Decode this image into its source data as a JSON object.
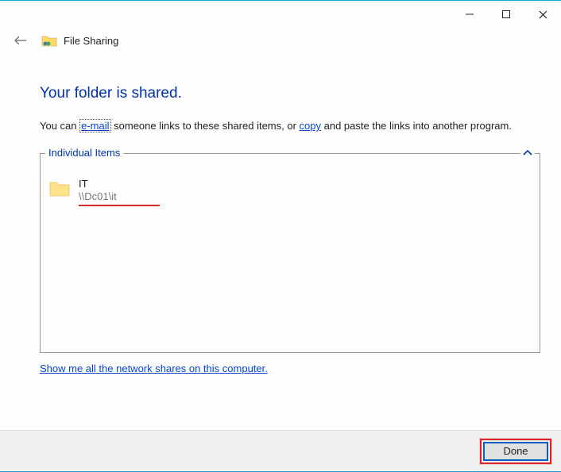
{
  "window": {
    "title": "File Sharing"
  },
  "heading": "Your folder is shared.",
  "paragraph": {
    "prefix": "You can ",
    "link1": "e-mail",
    "mid": " someone links to these shared items, or ",
    "link2": "copy",
    "suffix": " and paste the links into another program."
  },
  "group": {
    "legend": "Individual Items",
    "items": [
      {
        "name": "IT",
        "path": "\\\\Dc01\\it"
      }
    ]
  },
  "bottom_link": "Show me all the network shares on this computer.",
  "buttons": {
    "done": "Done"
  }
}
